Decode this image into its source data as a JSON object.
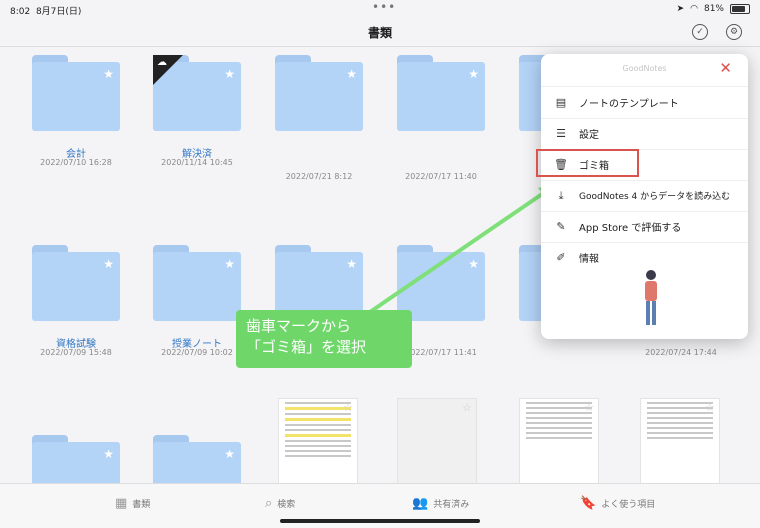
{
  "status": {
    "time": "8:02",
    "date": "8月7日(日)",
    "battery": "81%"
  },
  "nav": {
    "title": "書類"
  },
  "folders": [
    {
      "name": "会計",
      "date": "2022/07/10 16:28"
    },
    {
      "name": "解決済",
      "date": "2020/11/14 10:45"
    },
    {
      "name": "",
      "date": "2022/07/21 8:12"
    },
    {
      "name": "",
      "date": "2022/07/17 11:40"
    },
    {
      "name": "資格試験",
      "date": "2022/07/09 15:48"
    },
    {
      "name": "授業ノート",
      "date": "2022/07/09 10:02"
    },
    {
      "name": "",
      "date": ""
    },
    {
      "name": "",
      "date": "2022/07/17 11:41"
    },
    {
      "name": "",
      "date": "2022/07/24 17:44"
    }
  ],
  "popover": {
    "title": "GoodNotes",
    "items": [
      {
        "label": "ノートのテンプレート",
        "icon": "template-icon"
      },
      {
        "label": "設定",
        "icon": "sliders-icon"
      },
      {
        "label": "ゴミ箱",
        "icon": "trash-icon"
      },
      {
        "label": "GoodNotes 4 からデータを読み込む",
        "icon": "import-icon"
      },
      {
        "label": "App Store で評価する",
        "icon": "review-icon"
      },
      {
        "label": "情報",
        "icon": "info-icon"
      }
    ]
  },
  "tabbar": {
    "tabs": [
      {
        "label": "書類",
        "icon": "grid-icon"
      },
      {
        "label": "検索",
        "icon": "search-icon"
      },
      {
        "label": "共有済み",
        "icon": "people-icon"
      },
      {
        "label": "よく使う項目",
        "icon": "bookmark-icon"
      }
    ]
  },
  "annotation": {
    "line1": "歯車マークから",
    "line2": "「ゴミ箱」を選択"
  },
  "colors": {
    "folder": "#b3d3f7",
    "accent": "#3478c6",
    "highlight": "#d9534f",
    "annotation": "#6fd66a"
  }
}
